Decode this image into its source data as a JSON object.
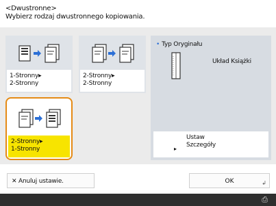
{
  "header": {
    "title": "<Dwustronne>",
    "subtitle": "Wybierz rodzaj dwustronnego kopiowania."
  },
  "options": [
    {
      "line1": "1-Stronny▸",
      "line2": "2-Stronny",
      "icon": "one-to-two-sided-icon",
      "selected": false
    },
    {
      "line1": "2-Stronny▸",
      "line2": "2-Stronny",
      "icon": "two-to-two-sided-icon",
      "selected": false
    },
    {
      "line1": "2-Stronny▸",
      "line2": "1-Stronny",
      "icon": "two-to-one-sided-icon",
      "selected": true
    }
  ],
  "original_type": {
    "label": "Typ Oryginału",
    "value": "Układ Książki",
    "icon": "book-layout-icon"
  },
  "settings_button": {
    "line1": "Ustaw",
    "line2": "Szczegóły"
  },
  "footer": {
    "cancel_label": "Anuluj ustawie.",
    "ok_label": "OK"
  },
  "colors": {
    "selected_border": "#e58a14",
    "selected_label": "#f7e400",
    "accent_dot": "#2b6fd6"
  }
}
